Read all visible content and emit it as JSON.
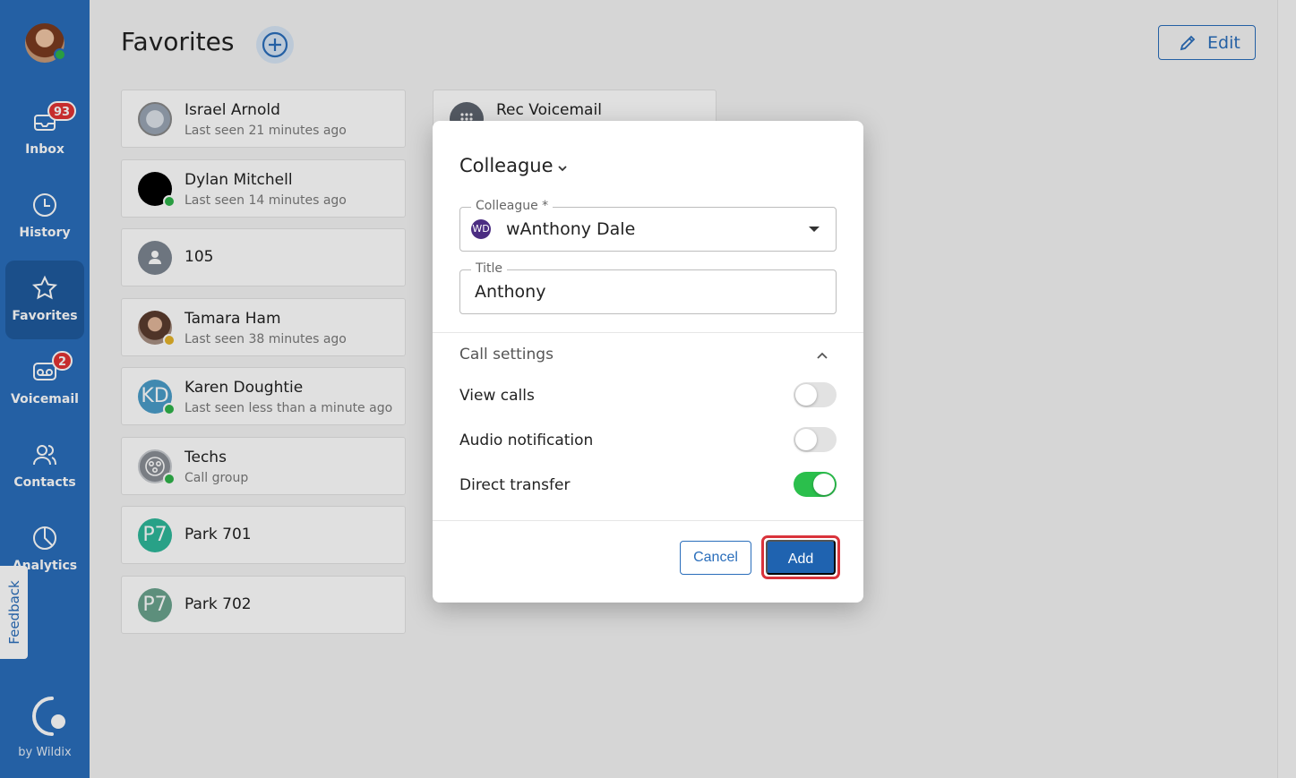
{
  "sidebar": {
    "nav": [
      {
        "label": "Inbox",
        "badge": "93",
        "icon": "inbox-icon"
      },
      {
        "label": "History",
        "badge": "",
        "icon": "clock-icon"
      },
      {
        "label": "Favorites",
        "badge": "",
        "icon": "star-icon"
      },
      {
        "label": "Voicemail",
        "badge": "2",
        "icon": "voicemail-icon"
      },
      {
        "label": "Contacts",
        "badge": "",
        "icon": "contacts-icon"
      },
      {
        "label": "Analytics",
        "badge": "",
        "icon": "pie-chart-icon"
      }
    ],
    "feedback": "Feedback",
    "brand": "by Wildix"
  },
  "header": {
    "title": "Favorites",
    "edit_label": "Edit"
  },
  "favorites": [
    {
      "name": "Israel Arnold",
      "sub": "Last seen 21 minutes ago"
    },
    {
      "name": "Dylan Mitchell",
      "sub": "Last seen 14 minutes ago"
    },
    {
      "name": "105",
      "sub": ""
    },
    {
      "name": "Tamara Ham",
      "sub": "Last seen 38 minutes ago"
    },
    {
      "name": "Karen Doughtie",
      "sub": "Last seen less than a minute ago",
      "initials": "KD"
    },
    {
      "name": "Techs",
      "sub": "Call group"
    },
    {
      "name": "Park 701",
      "sub": "",
      "initials": "P7"
    },
    {
      "name": "Park 702",
      "sub": "",
      "initials": "P7"
    }
  ],
  "rec_voicemail": {
    "name": "Rec Voicemail"
  },
  "dialog": {
    "type_label": "Colleague",
    "colleague_field": {
      "label": "Colleague *",
      "initials": "WD",
      "value": "wAnthony Dale"
    },
    "title_field": {
      "label": "Title",
      "value": "Anthony"
    },
    "call_settings": {
      "title": "Call settings",
      "items": [
        {
          "label": "View calls",
          "on": false
        },
        {
          "label": "Audio notification",
          "on": false
        },
        {
          "label": "Direct transfer",
          "on": true
        }
      ]
    },
    "cancel_label": "Cancel",
    "add_label": "Add"
  },
  "colors": {
    "sidebar": "#2a6ebb",
    "accent": "#1f63b0",
    "toggle_on": "#2bbf4c",
    "highlight": "#d9333b",
    "badge": "#e23434"
  }
}
